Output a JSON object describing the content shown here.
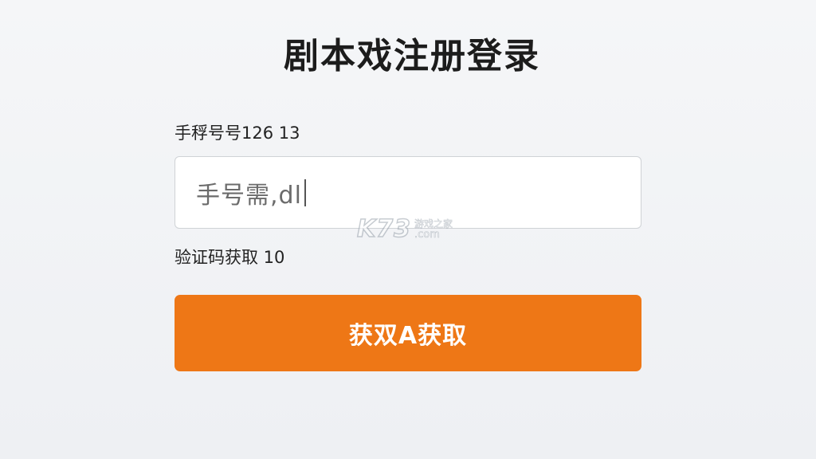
{
  "page": {
    "title": "剧本戏注册登录"
  },
  "form": {
    "phone_label": "手稃号号126 13",
    "phone_input_value": "手号需,dl",
    "code_label": "验证码获取 10",
    "get_code_button_label": "获双A获取"
  },
  "watermark": {
    "logo": "K73",
    "site_name": "游戏之家",
    "domain": ".com"
  },
  "colors": {
    "accent": "#ee7716",
    "background": "#f3f4f6",
    "input_border": "#cfd2d6"
  }
}
